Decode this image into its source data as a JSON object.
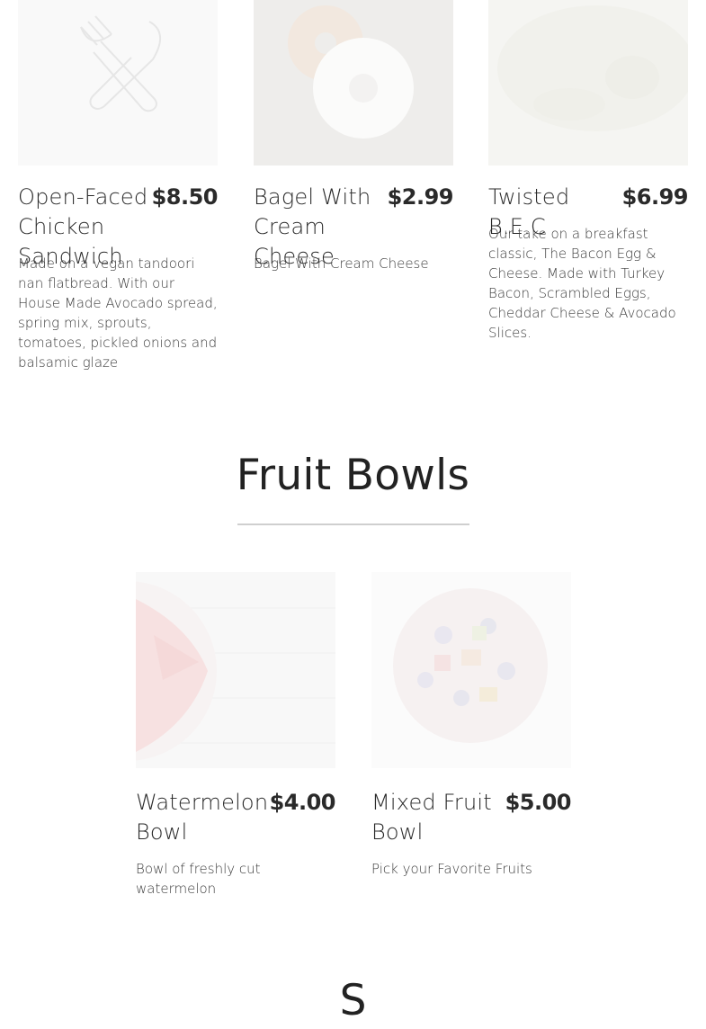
{
  "sections": {
    "previous": {
      "items": [
        {
          "name": "Open-Faced Chicken Sandwich",
          "price": "$8.50",
          "description": "Made on a vegan tandoori nan flatbread. With our House Made Avocado spread, spring mix, sprouts, tomatoes, pickled onions and balsamic glaze",
          "image_icon": "fork-knife-icon"
        },
        {
          "name": "Bagel With Cream Cheese",
          "price": "$2.99",
          "description": "Bagel With Cream Cheese",
          "image_icon": "bagel-photo"
        },
        {
          "name": "Twisted B.E.C",
          "price": "$6.99",
          "description": "Our take on a breakfast classic, The Bacon Egg & Cheese. Made with Turkey Bacon, Scrambled Eggs, Cheddar Cheese & Avocado Slices.",
          "image_icon": "sandwich-photo"
        }
      ]
    },
    "fruit_bowls": {
      "title": "Fruit Bowls",
      "items": [
        {
          "name": "Watermelon Bowl",
          "price": "$4.00",
          "description": "Bowl of freshly cut watermelon",
          "image_icon": "watermelon-bowl-photo"
        },
        {
          "name": "Mixed Fruit Bowl",
          "price": "$5.00",
          "description": "Pick your Favorite Fruits",
          "image_icon": "mixed-fruit-photo"
        }
      ]
    },
    "next": {
      "title": "S"
    }
  }
}
